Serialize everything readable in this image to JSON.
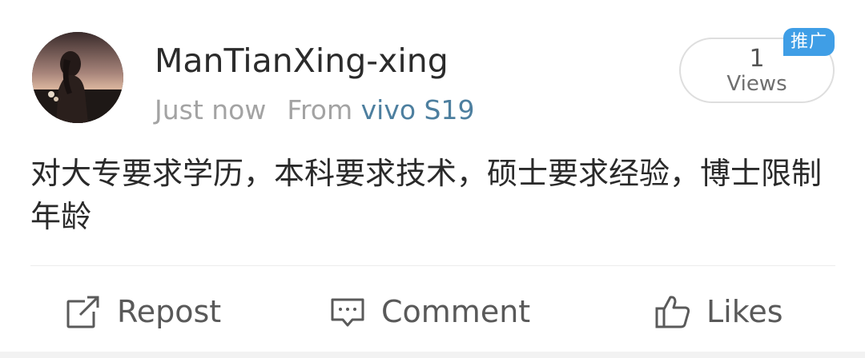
{
  "post": {
    "username": "ManTianXing-xing",
    "time": "Just now",
    "from_label": "From",
    "device": "vivo S19",
    "text": "对大专要求学历，本科要求技术，硕士要求经验，博士限制年龄"
  },
  "views": {
    "count": "1",
    "label": "Views"
  },
  "promo_badge": "推广",
  "actions": {
    "repost": "Repost",
    "comment": "Comment",
    "like": "Likes"
  },
  "icons": {
    "avatar": "user-photo-avatar",
    "repost": "repost-icon",
    "comment": "comment-icon",
    "like": "thumbs-up-icon"
  },
  "colors": {
    "device_link": "#4d7f9f",
    "badge": "#3f9ee6",
    "meta_text": "#a3a3a3"
  }
}
